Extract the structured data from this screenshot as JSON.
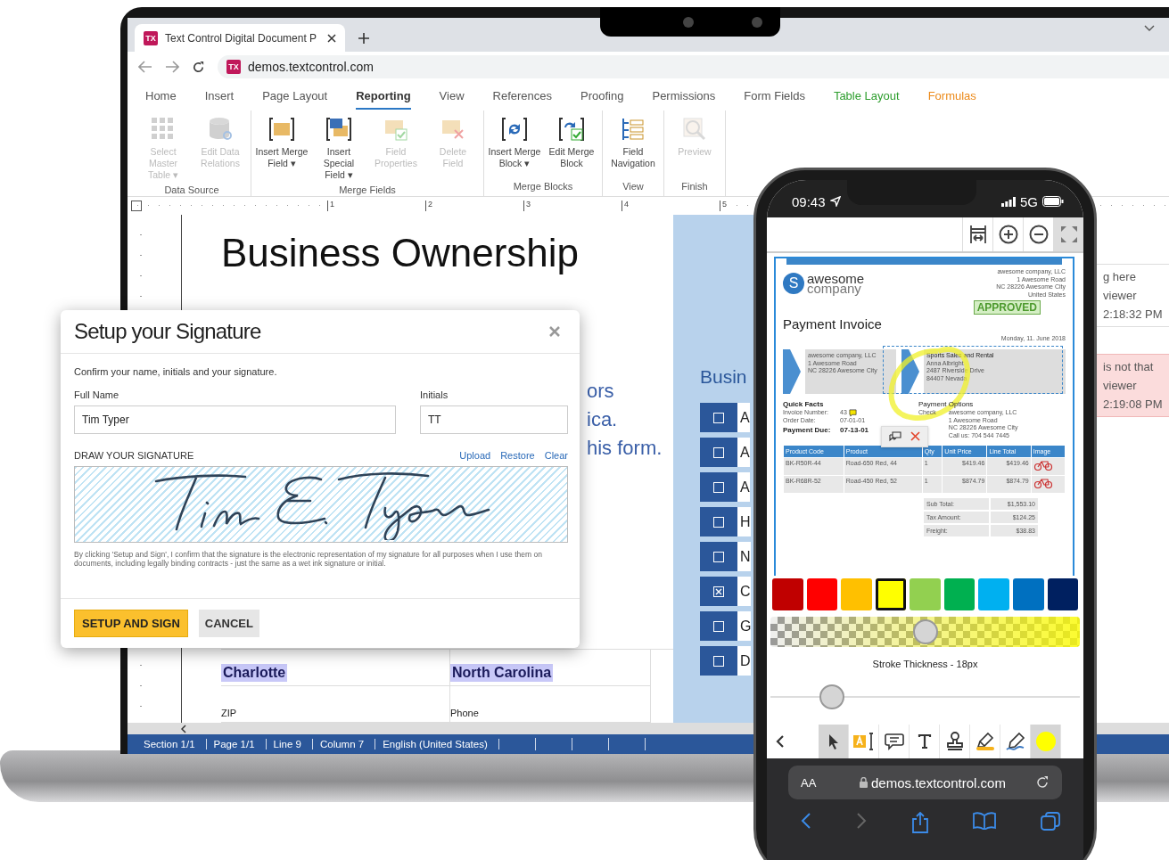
{
  "browser": {
    "tab_icon_text": "TX",
    "tab_title": "Text Control Digital Document P",
    "url_icon_text": "TX",
    "url": "demos.textcontrol.com"
  },
  "ribbon": {
    "tabs": [
      {
        "label": "Home",
        "selected": false,
        "kind": "normal"
      },
      {
        "label": "Insert",
        "selected": false,
        "kind": "normal"
      },
      {
        "label": "Page Layout",
        "selected": false,
        "kind": "normal"
      },
      {
        "label": "Reporting",
        "selected": true,
        "kind": "normal"
      },
      {
        "label": "View",
        "selected": false,
        "kind": "normal"
      },
      {
        "label": "References",
        "selected": false,
        "kind": "normal"
      },
      {
        "label": "Proofing",
        "selected": false,
        "kind": "normal"
      },
      {
        "label": "Permissions",
        "selected": false,
        "kind": "normal"
      },
      {
        "label": "Form Fields",
        "selected": false,
        "kind": "normal"
      },
      {
        "label": "Table Layout",
        "selected": false,
        "kind": "table"
      },
      {
        "label": "Formulas",
        "selected": false,
        "kind": "formula"
      }
    ],
    "groups": [
      {
        "label": "Data Source",
        "buttons": [
          {
            "label": [
              "Select Master",
              "Table ▾"
            ],
            "kind": "grid",
            "disabled": true
          },
          {
            "label": [
              "Edit Data",
              "Relations"
            ],
            "kind": "database",
            "disabled": true
          }
        ]
      },
      {
        "label": "Merge Fields",
        "buttons": [
          {
            "label": [
              "Insert Merge",
              "Field ▾"
            ],
            "kind": "field",
            "disabled": false
          },
          {
            "label": [
              "Insert Special",
              "Field ▾"
            ],
            "kind": "special",
            "disabled": false
          },
          {
            "label": [
              "Field",
              "Properties"
            ],
            "kind": "properties",
            "disabled": true
          },
          {
            "label": [
              "Delete",
              "Field"
            ],
            "kind": "delete",
            "disabled": true
          }
        ]
      },
      {
        "label": "Merge Blocks",
        "buttons": [
          {
            "label": [
              "Insert Merge",
              "Block ▾"
            ],
            "kind": "block",
            "disabled": false
          },
          {
            "label": [
              "Edit Merge",
              "Block"
            ],
            "kind": "editblock",
            "disabled": false
          }
        ]
      },
      {
        "label": "View",
        "buttons": [
          {
            "label": [
              "Field",
              "Navigation"
            ],
            "kind": "navigation",
            "disabled": false
          }
        ]
      },
      {
        "label": "Finish",
        "buttons": [
          {
            "label": [
              "Preview"
            ],
            "kind": "preview",
            "disabled": true
          }
        ]
      }
    ]
  },
  "ruler": {
    "marks": [
      "1",
      "2",
      "3",
      "4",
      "5"
    ]
  },
  "document": {
    "heading": [
      "Business Ownership"
    ],
    "fragments": [
      "ors",
      "ica.",
      "his form."
    ],
    "form": [
      {
        "value": "Charlotte"
      },
      {
        "value": "North Carolina"
      },
      {
        "label": "ZIP"
      },
      {
        "label": "Phone"
      }
    ],
    "side_heading": "Busin",
    "checklist": [
      {
        "letter": "A",
        "checked": false
      },
      {
        "letter": "A",
        "checked": false
      },
      {
        "letter": "A",
        "checked": false
      },
      {
        "letter": "H",
        "checked": false
      },
      {
        "letter": "N",
        "checked": false
      },
      {
        "letter": "C",
        "checked": true
      },
      {
        "letter": "G",
        "checked": false
      },
      {
        "letter": "D",
        "checked": false
      }
    ]
  },
  "status_bar": [
    "Section 1/1",
    "Page 1/1",
    "Line 9",
    "Column 7",
    "English (United States)"
  ],
  "side_window": {
    "cards": [
      {
        "lines": [
          "g here",
          "viewer",
          "2:18:32 PM"
        ],
        "kind": "plain"
      },
      {
        "lines": [
          "is not that",
          "viewer",
          "2:19:08 PM"
        ],
        "kind": "flagged"
      }
    ]
  },
  "dialog": {
    "title": "Setup your Signature",
    "intro": "Confirm your name, initials and your signature.",
    "full_name_label": "Full Name",
    "full_name": "Tim Typer",
    "initials_label": "Initials",
    "initials": "TT",
    "draw_label": "DRAW YOUR SIGNATURE",
    "links": [
      "Upload",
      "Restore",
      "Clear"
    ],
    "disclaimer": "By clicking 'Setup and Sign', I confirm that the signature is the electronic representation of my signature for all purposes when I use them on documents, including legally binding contracts - just the same as a wet ink signature or initial.",
    "primary_button": "SETUP AND SIGN",
    "cancel_button": "CANCEL"
  },
  "phone": {
    "time": "09:43",
    "network": "5G",
    "invoice": {
      "logo_letter": "S",
      "logo_top": "awesome",
      "logo_bottom": "company",
      "address": [
        "awesome company, LLC",
        "1 Awesome Road",
        "NC 28226 Awesome City",
        "United States"
      ],
      "stamp": "APPROVED",
      "title": "Payment Invoice",
      "date": "Monday, 11. June 2018",
      "sender": [
        "awesome company, LLC",
        "1 Awesome Road",
        "NC 28226 Awesome City"
      ],
      "recipient": [
        "Sports Sales and Rental",
        "Anna Albright",
        "2487 Riverside Drive",
        "84407 Nevada"
      ],
      "facts_title": "Quick Facts",
      "facts": [
        {
          "label": "Invoice Number:",
          "value": "43"
        },
        {
          "label": "Order Date:",
          "value": "07-01-01"
        },
        {
          "label": "Payment Due:",
          "value": "07-13-01"
        }
      ],
      "options_title": "Payment Options",
      "options_method": "Check",
      "options_address": [
        "awesome company, LLC",
        "1 Awesome Road",
        "NC 28226 Awesome City",
        "Call us: 704 544 7445"
      ],
      "columns": [
        "Product Code",
        "Product",
        "Qty",
        "Unit Price",
        "Line Total",
        "Image"
      ],
      "rows": [
        [
          "BK-R50R-44",
          "Road-650 Red, 44",
          "1",
          "$419.46",
          "$419.46"
        ],
        [
          "BK-R68R-52",
          "Road-450 Red, 52",
          "1",
          "$874.79",
          "$874.79"
        ]
      ],
      "totals": [
        {
          "label": "Sub Total:",
          "value": "$1,553.10"
        },
        {
          "label": "Tax Amount:",
          "value": "$124.25"
        },
        {
          "label": "Freight:",
          "value": "$38.83"
        }
      ]
    },
    "palette": [
      {
        "color": "#c00000",
        "selected": false
      },
      {
        "color": "#ff0000",
        "selected": false
      },
      {
        "color": "#ffc000",
        "selected": false
      },
      {
        "color": "#ffff00",
        "selected": true
      },
      {
        "color": "#92d050",
        "selected": false
      },
      {
        "color": "#00b050",
        "selected": false
      },
      {
        "color": "#00b0f0",
        "selected": false
      },
      {
        "color": "#0070c0",
        "selected": false
      },
      {
        "color": "#002060",
        "selected": false
      }
    ],
    "opacity": {
      "level": 0.5
    },
    "stroke_label": "Stroke Thickness - 18px",
    "thickness": {
      "level": 0.2
    },
    "tools": [
      {
        "kind": "back",
        "selected": false
      },
      {
        "kind": "pointer",
        "selected": true
      },
      {
        "kind": "text-highlight",
        "selected": false
      },
      {
        "kind": "comment",
        "selected": false
      },
      {
        "kind": "text",
        "selected": false
      },
      {
        "kind": "stamp",
        "selected": false
      },
      {
        "kind": "highlighter",
        "selected": false
      },
      {
        "kind": "pen",
        "selected": false
      },
      {
        "kind": "color",
        "selected": true
      }
    ],
    "safari": {
      "text_size": "AA",
      "url": "demos.textcontrol.com"
    }
  }
}
